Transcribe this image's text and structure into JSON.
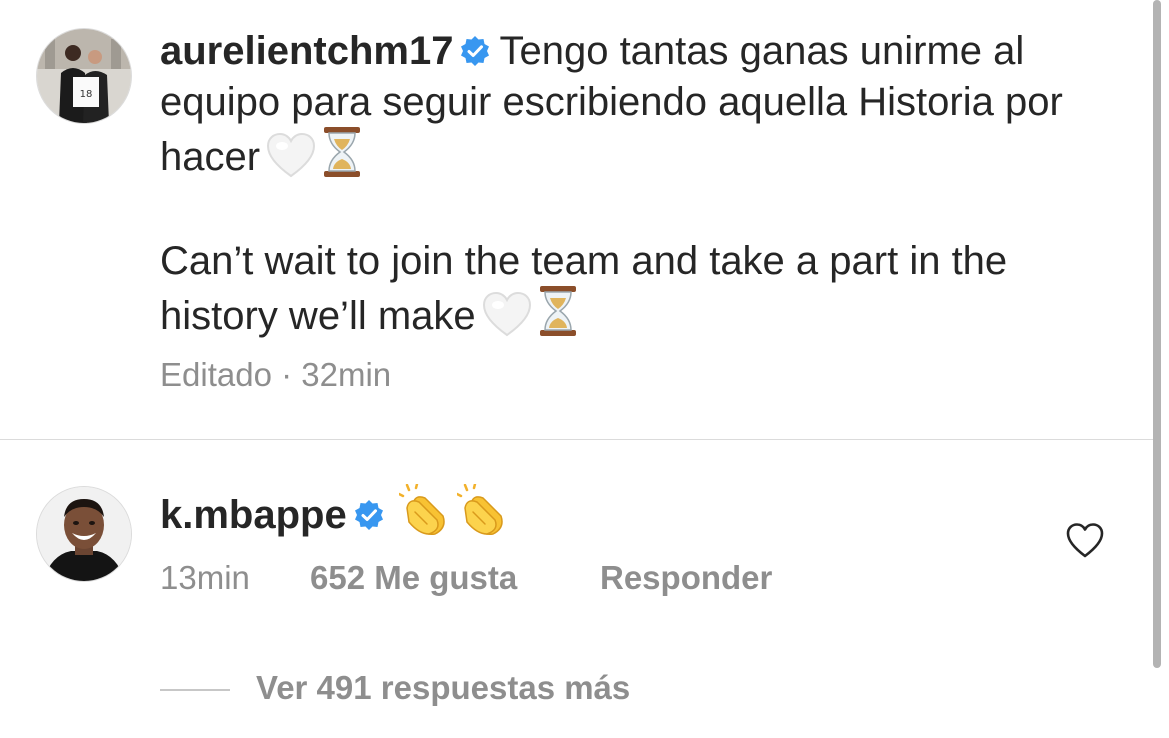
{
  "caption": {
    "username": "aurelientchm17",
    "text_es": "Tengo tantas ganas unirme al equipo para seguir escribiendo aquella Historia por hacer",
    "text_en": "Can’t wait to join the team and take a part in the history we’ll make",
    "emojis": [
      "white-heart-icon",
      "hourglass-icon"
    ],
    "edited_label": "Editado",
    "separator": "·",
    "time": "32min"
  },
  "comment": {
    "username": "k.mbappe",
    "emojis": [
      "clapping-hands-icon",
      "clapping-hands-icon"
    ],
    "time": "13min",
    "likes": "652 Me gusta",
    "reply_label": "Responder"
  },
  "replies": {
    "label": "Ver 491 respuestas más"
  },
  "colors": {
    "text": "#262626",
    "secondary": "#8e8e8e",
    "verified": "#3897f0",
    "divider": "#dbdbdb"
  }
}
